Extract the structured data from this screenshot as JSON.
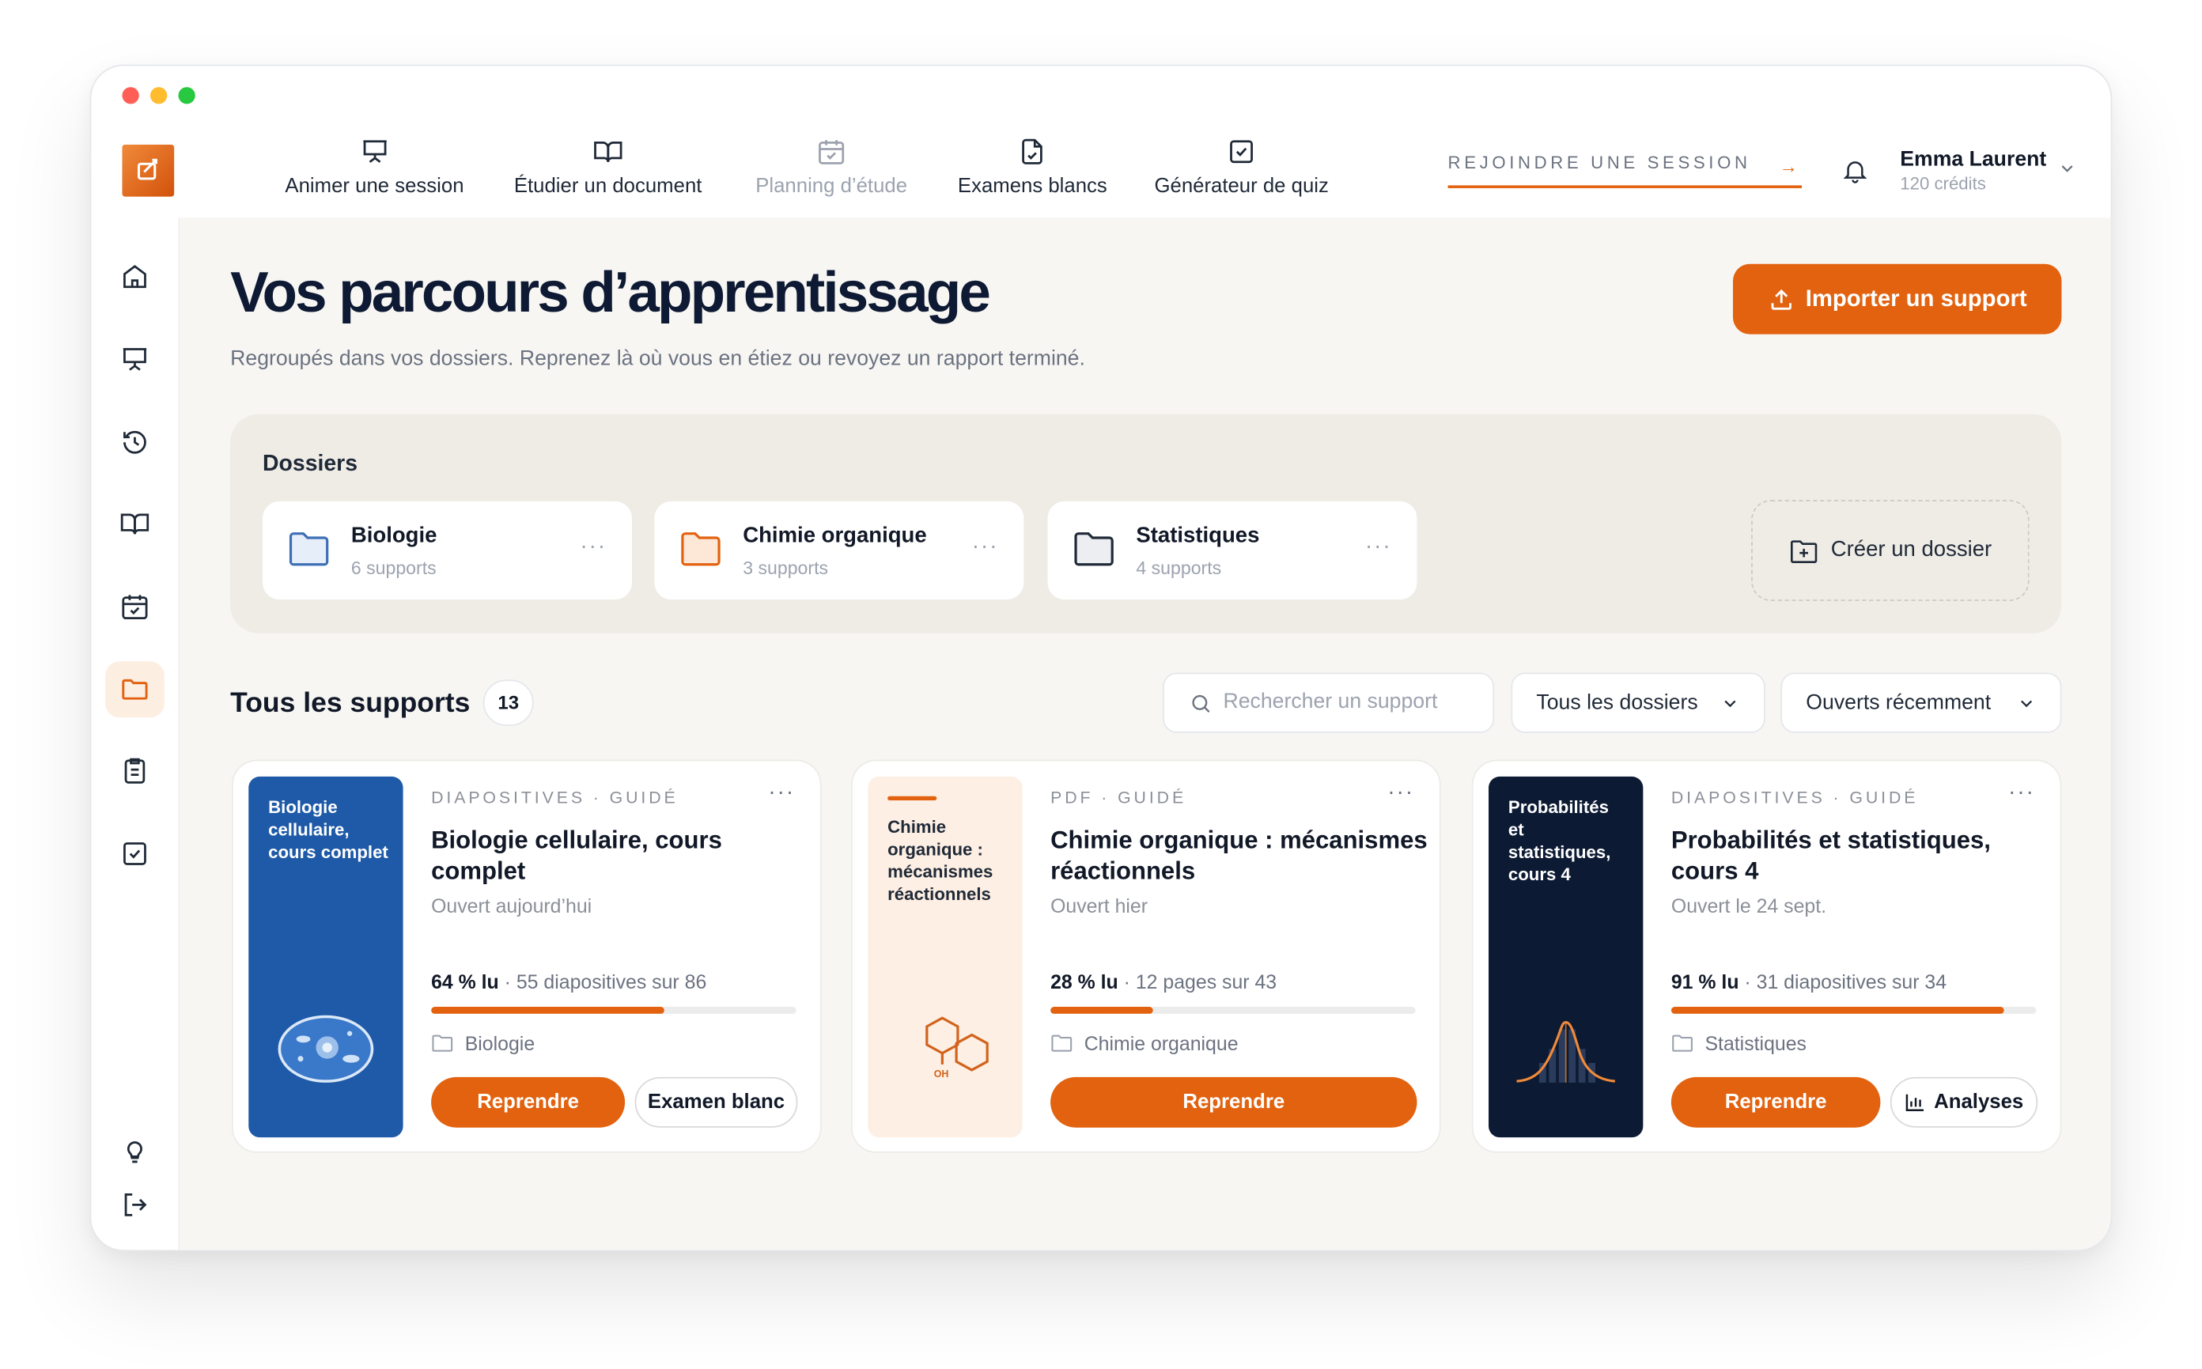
{
  "colors": {
    "accent": "#e2620f",
    "navy": "#0e1a33",
    "blue_cover": "#1e5aa8",
    "peach_cover": "#fdefe3",
    "dark_cover": "#0c1a33"
  },
  "nav": [
    {
      "label": "Animer une session",
      "icon": "presentation-icon",
      "state": "default"
    },
    {
      "label": "Étudier un document",
      "icon": "book-open-icon",
      "state": "default"
    },
    {
      "label": "Planning d’étude",
      "icon": "calendar-check-icon",
      "state": "disabled"
    },
    {
      "label": "Examens blancs",
      "icon": "file-check-icon",
      "state": "default"
    },
    {
      "label": "Générateur de quiz",
      "icon": "checkbox-icon",
      "state": "default"
    }
  ],
  "join_session": "REJOINDRE UNE SESSION",
  "user": {
    "name": "Emma Laurent",
    "credits": "120 crédits"
  },
  "sidebar": [
    "home-icon",
    "presentation-icon",
    "history-icon",
    "book-icon",
    "calendar-icon",
    "folder-icon",
    "clipboard-icon",
    "checkbox-icon",
    "lightbulb-icon",
    "logout-icon"
  ],
  "sidebar_active": "folder-icon",
  "page": {
    "title": "Vos parcours d’apprentissage",
    "subtitle": "Regroupés dans vos dossiers. Reprenez là où vous en étiez ou revoyez un rapport terminé.",
    "import_label": "Importer un support"
  },
  "folders": {
    "title": "Dossiers",
    "items": [
      {
        "name": "Biologie",
        "count": "6 supports",
        "color": "#3d6fb6",
        "fill": "#e6eef9"
      },
      {
        "name": "Chimie organique",
        "count": "3 supports",
        "color": "#e2620f",
        "fill": "#fde8d8"
      },
      {
        "name": "Statistiques",
        "count": "4 supports",
        "color": "#1f2937",
        "fill": "#eceef1"
      }
    ],
    "create_label": "Créer un dossier"
  },
  "supports": {
    "title": "Tous les supports",
    "count": "13",
    "search_placeholder": "Rechercher un support",
    "filter_folder": "Tous les dossiers",
    "filter_sort": "Ouverts récemment",
    "items": [
      {
        "cover_text": "Biologie cellulaire, cours complet",
        "kicker": "DIAPOSITIVES · GUIDÉ",
        "title": "Biologie cellulaire, cours complet",
        "opened": "Ouvert aujourd’hui",
        "progress_label": "64 % lu",
        "progress_detail": " · 55 diapositives sur 86",
        "progress": 0.64,
        "folder": "Biologie",
        "primary": "Reprendre",
        "secondary": "Examen blanc"
      },
      {
        "cover_text": "Chimie organique : mécanismes réactionnels",
        "cover_label": "OH",
        "kicker": "PDF · GUIDÉ",
        "title": "Chimie organique : mécanismes réactionnels",
        "opened": "Ouvert hier",
        "progress_label": "28 % lu",
        "progress_detail": " · 12 pages sur 43",
        "progress": 0.28,
        "folder": "Chimie organique",
        "primary": "Reprendre"
      },
      {
        "cover_text": "Probabilités et statistiques, cours 4",
        "kicker": "DIAPOSITIVES · GUIDÉ",
        "title": "Probabilités et statistiques, cours 4",
        "opened": "Ouvert le 24 sept.",
        "progress_label": "91 % lu",
        "progress_detail": " · 31 diapositives sur 34",
        "progress": 0.91,
        "folder": "Statistiques",
        "primary": "Reprendre",
        "secondary": "Analyses"
      }
    ]
  }
}
